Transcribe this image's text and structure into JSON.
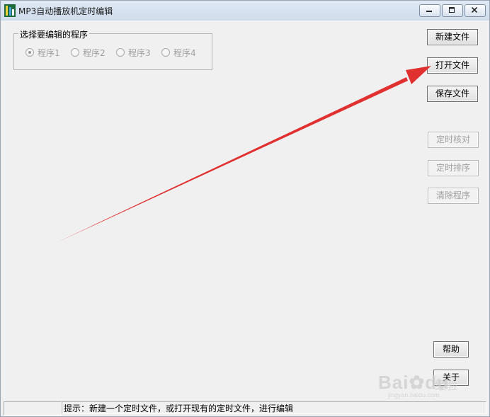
{
  "window": {
    "title": "MP3自动播放机定时编辑",
    "controls": [
      "minimize-icon",
      "maximize-icon",
      "close-icon"
    ]
  },
  "program_group": {
    "title": "选择要编辑的程序",
    "options": [
      {
        "label": "程序1",
        "selected": true
      },
      {
        "label": "程序2",
        "selected": false
      },
      {
        "label": "程序3",
        "selected": false
      },
      {
        "label": "程序4",
        "selected": false
      }
    ]
  },
  "buttons": {
    "new_file": "新建文件",
    "open_file": "打开文件",
    "save_file": "保存文件",
    "timing_check": "定时核对",
    "timing_sort": "定时排序",
    "clear_program": "清除程序",
    "help": "帮助",
    "about": "关于"
  },
  "statusbar": {
    "pane1": "",
    "hint": "提示：新建一个定时文件，或打开现有的定时文件，进行编辑"
  },
  "annotation": {
    "arrow_color": "#e03030",
    "points_to": "open_file"
  },
  "watermark": {
    "brand": "Bai",
    "brand2": "du",
    "suffix": "经验",
    "url": "jingyan.baidu.com"
  }
}
